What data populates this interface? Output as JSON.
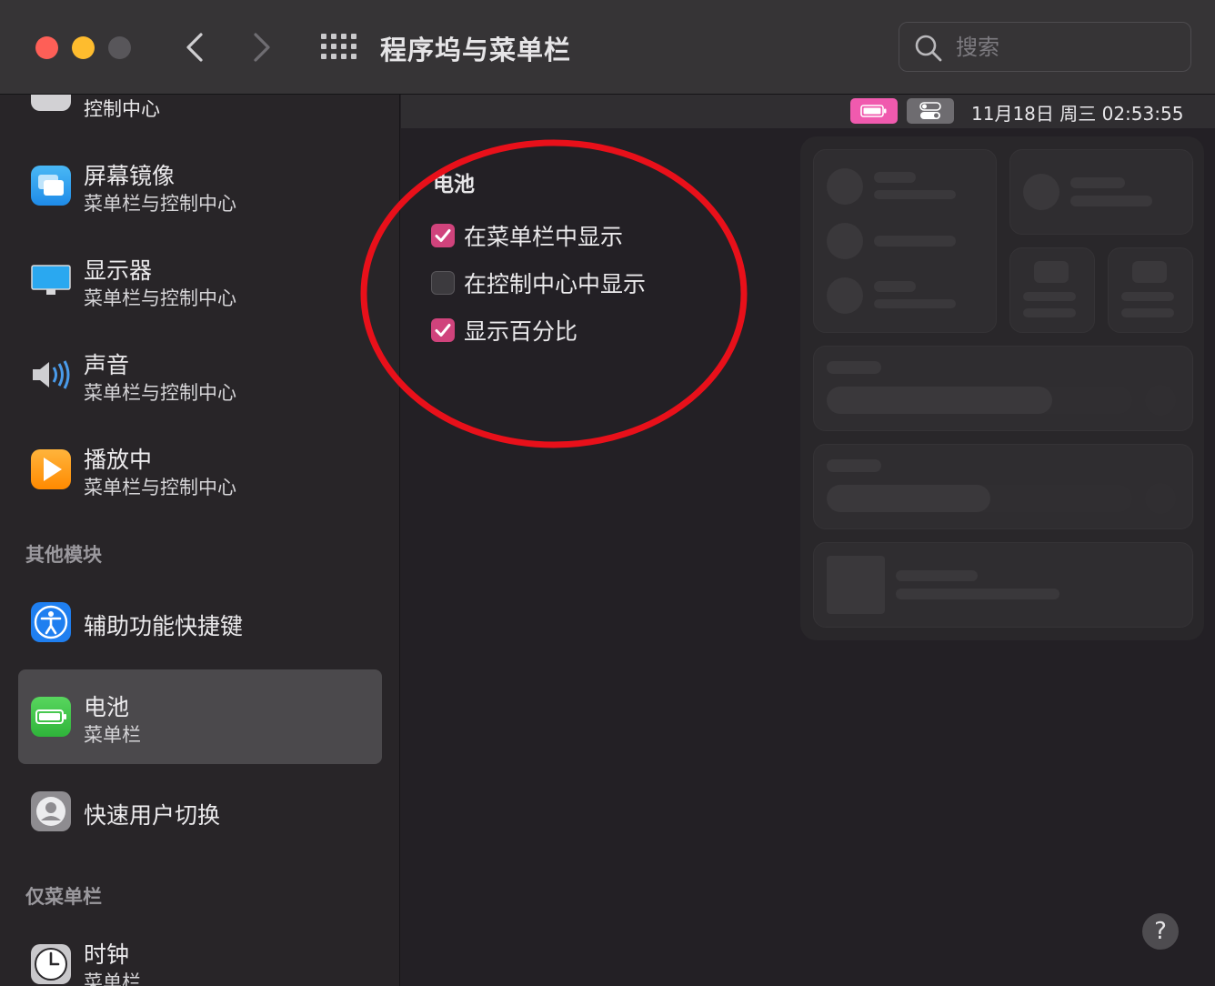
{
  "window": {
    "title": "程序坞与菜单栏",
    "search_placeholder": "搜索"
  },
  "sidebar": {
    "items": [
      {
        "label": "控制中心",
        "sub": "",
        "icon": "control-center-icon"
      },
      {
        "label": "屏幕镜像",
        "sub": "菜单栏与控制中心",
        "icon": "screen-mirroring-icon"
      },
      {
        "label": "显示器",
        "sub": "菜单栏与控制中心",
        "icon": "display-icon"
      },
      {
        "label": "声音",
        "sub": "菜单栏与控制中心",
        "icon": "speaker-icon"
      },
      {
        "label": "播放中",
        "sub": "菜单栏与控制中心",
        "icon": "now-playing-icon"
      }
    ],
    "section_other": "其他模块",
    "other_items": [
      {
        "label": "辅助功能快捷键",
        "sub": "",
        "icon": "accessibility-icon"
      },
      {
        "label": "电池",
        "sub": "菜单栏",
        "icon": "battery-icon",
        "selected": true
      },
      {
        "label": "快速用户切换",
        "sub": "",
        "icon": "user-switch-icon"
      }
    ],
    "section_menubar_only": "仅菜单栏",
    "menubar_items": [
      {
        "label": "时钟",
        "sub": "菜单栏",
        "icon": "clock-icon"
      }
    ]
  },
  "menubar_preview": {
    "datetime": "11月18日 周三  02:53:55"
  },
  "battery": {
    "section_title": "电池",
    "options": [
      {
        "label": "在菜单栏中显示",
        "checked": true
      },
      {
        "label": "在控制中心中显示",
        "checked": false
      },
      {
        "label": "显示百分比",
        "checked": true
      }
    ]
  },
  "help": {
    "label": "?"
  },
  "colors": {
    "accent": "#d0437c",
    "menubar_battery": "#f05aae",
    "annotation": "#e8101a"
  }
}
